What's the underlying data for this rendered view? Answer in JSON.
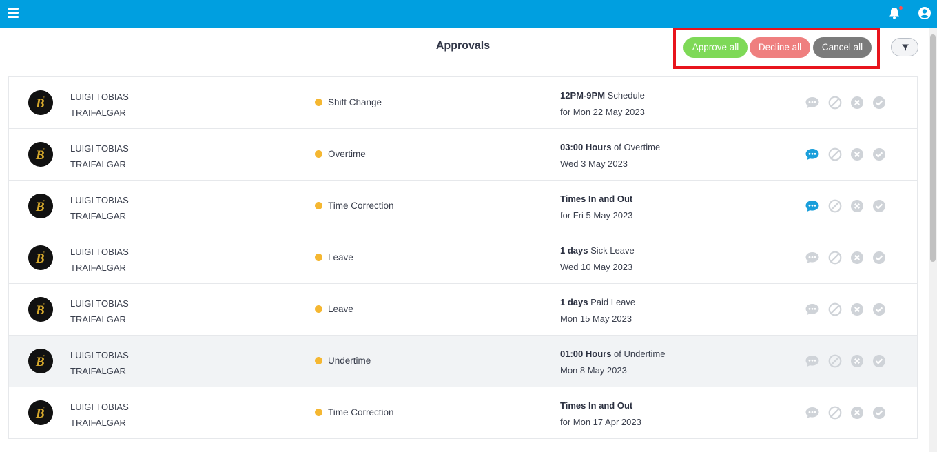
{
  "header": {
    "menu_icon": "hamburger-menu-icon",
    "bell_icon": "bell-icon",
    "user_icon": "user-account-icon"
  },
  "page": {
    "title": "Approvals"
  },
  "bulk_actions": {
    "approve_all": "Approve all",
    "decline_all": "Decline all",
    "cancel_all": "Cancel all",
    "filter_icon": "filter-funnel-icon"
  },
  "colors": {
    "accent": "#009fe0",
    "approve": "#7ed957",
    "decline": "#ef7f7f",
    "cancel": "#7b7b7b",
    "status_pending": "#f5b731",
    "comment_active": "#1a9fdb",
    "highlight_border": "#e8141c"
  },
  "rows": [
    {
      "first_name": "LUIGI TOBIAS",
      "last_name": "TRAIFALGAR",
      "type": "Shift Change",
      "detail_bold": "12PM-9PM",
      "detail_text": " Schedule",
      "date_line": "for Mon 22 May 2023",
      "comment_active": false
    },
    {
      "first_name": "LUIGI TOBIAS",
      "last_name": "TRAIFALGAR",
      "type": "Overtime",
      "detail_bold": "03:00 Hours",
      "detail_text": " of Overtime",
      "date_line": "Wed 3 May 2023",
      "comment_active": true
    },
    {
      "first_name": "LUIGI TOBIAS",
      "last_name": "TRAIFALGAR",
      "type": "Time Correction",
      "detail_bold": "Times In and Out",
      "detail_text": "",
      "date_line": "for Fri 5 May 2023",
      "comment_active": true
    },
    {
      "first_name": "LUIGI TOBIAS",
      "last_name": "TRAIFALGAR",
      "type": "Leave",
      "detail_bold": "1 days",
      "detail_text": " Sick Leave",
      "date_line": "Wed 10 May 2023",
      "comment_active": false
    },
    {
      "first_name": "LUIGI TOBIAS",
      "last_name": "TRAIFALGAR",
      "type": "Leave",
      "detail_bold": "1 days",
      "detail_text": " Paid Leave",
      "date_line": "Mon 15 May 2023",
      "comment_active": false
    },
    {
      "first_name": "LUIGI TOBIAS",
      "last_name": "TRAIFALGAR",
      "type": "Undertime",
      "detail_bold": "01:00 Hours",
      "detail_text": " of Undertime",
      "date_line": "Mon 8 May 2023",
      "comment_active": false
    },
    {
      "first_name": "LUIGI TOBIAS",
      "last_name": "TRAIFALGAR",
      "type": "Time Correction",
      "detail_bold": "Times In and Out",
      "detail_text": "",
      "date_line": "for Mon 17 Apr 2023",
      "comment_active": false
    }
  ]
}
